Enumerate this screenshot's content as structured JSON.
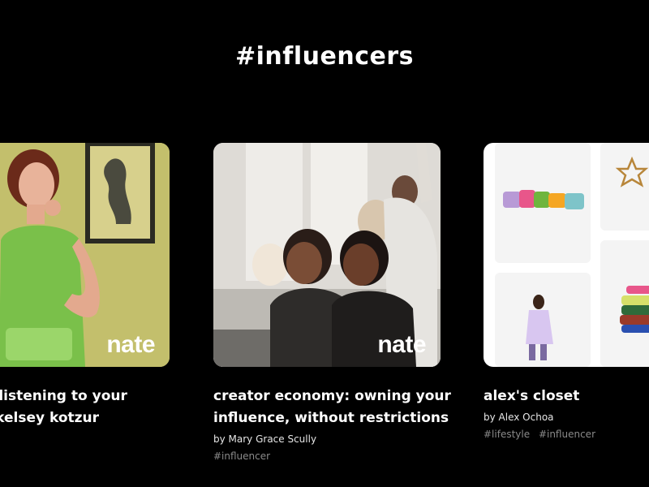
{
  "section": {
    "title": "#influencers"
  },
  "cards": [
    {
      "title_lines": [
        "convo: listening to your",
        "e with kelsey kotzur"
      ],
      "author": "",
      "tags": [],
      "brand": "nate"
    },
    {
      "title_lines": [
        "creator economy: owning your",
        "influence, without restrictions"
      ],
      "author": "by Mary Grace Scully",
      "tags": [
        "#influencer"
      ],
      "brand": "nate"
    },
    {
      "title_lines": [
        "alex's closet"
      ],
      "author": "by Alex Ochoa",
      "tags": [
        "#lifestyle",
        "#influencer"
      ]
    }
  ],
  "colors": {
    "background": "#000000",
    "text": "#ffffff",
    "tag": "#8a8a8a",
    "card1_bg": "#c7c46e",
    "card2_bg": "#d9d6d0",
    "card3_bg": "#ffffff"
  }
}
